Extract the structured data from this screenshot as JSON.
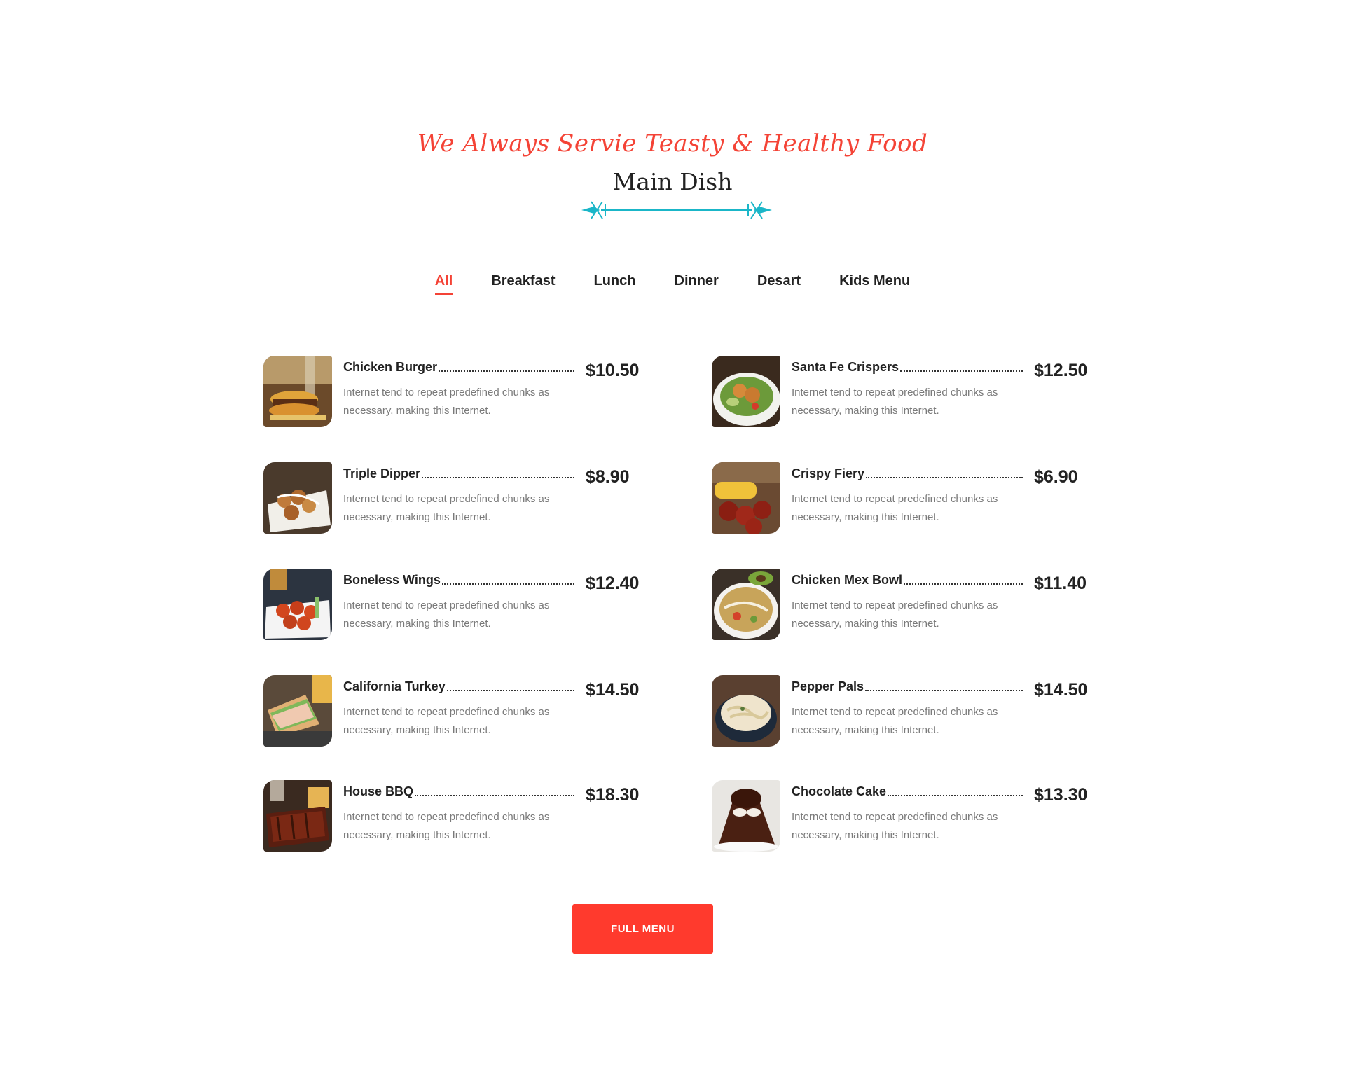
{
  "header": {
    "tagline": "We Always Servie Teasty & Healthy Food",
    "title": "Main Dish"
  },
  "tabs": [
    {
      "label": "All",
      "active": true
    },
    {
      "label": "Breakfast",
      "active": false
    },
    {
      "label": "Lunch",
      "active": false
    },
    {
      "label": "Dinner",
      "active": false
    },
    {
      "label": "Desart",
      "active": false
    },
    {
      "label": "Kids Menu",
      "active": false
    }
  ],
  "menu": {
    "left": [
      {
        "name": "Chicken Burger",
        "price": "$10.50",
        "desc": "Internet tend to repeat predefined chunks as necessary, making this Internet.",
        "image": "burger"
      },
      {
        "name": "Triple Dipper",
        "price": "$8.90",
        "desc": "Internet tend to repeat predefined chunks as necessary, making this Internet.",
        "image": "dipper"
      },
      {
        "name": "Boneless Wings",
        "price": "$12.40",
        "desc": "Internet tend to repeat predefined chunks as necessary, making this Internet.",
        "image": "wings"
      },
      {
        "name": "California Turkey",
        "price": "$14.50",
        "desc": "Internet tend to repeat predefined chunks as necessary, making this Internet.",
        "image": "sandwich"
      },
      {
        "name": "House BBQ",
        "price": "$18.30",
        "desc": "Internet tend to repeat predefined chunks as necessary, making this Internet.",
        "image": "ribs"
      }
    ],
    "right": [
      {
        "name": "Santa Fe Crispers",
        "price": "$12.50",
        "desc": "Internet tend to repeat predefined chunks as necessary, making this Internet.",
        "image": "salad"
      },
      {
        "name": "Crispy Fiery",
        "price": "$6.90",
        "desc": "Internet tend to repeat predefined chunks as necessary, making this Internet.",
        "image": "fiery"
      },
      {
        "name": "Chicken Mex Bowl",
        "price": "$11.40",
        "desc": "Internet tend to repeat predefined chunks as necessary, making this Internet.",
        "image": "bowl"
      },
      {
        "name": "Pepper Pals",
        "price": "$14.50",
        "desc": "Internet tend to repeat predefined chunks as necessary, making this Internet.",
        "image": "pasta"
      },
      {
        "name": "Chocolate Cake",
        "price": "$13.30",
        "desc": "Internet tend to repeat predefined chunks as necessary, making this Internet.",
        "image": "cake"
      }
    ]
  },
  "full_menu_label": "FULL MENU",
  "colors": {
    "accent": "#f44336",
    "divider": "#1ab6c8",
    "button": "#ff3a2d"
  }
}
